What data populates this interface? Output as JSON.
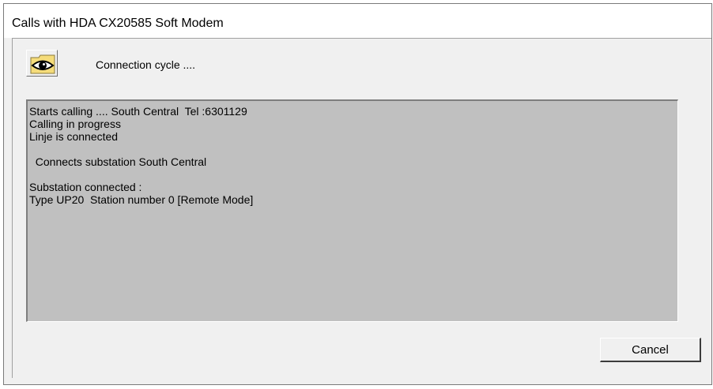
{
  "window": {
    "title": "Calls with HDA CX20585 Soft Modem"
  },
  "status": {
    "icon": "eye-icon",
    "label": "Connection cycle ...."
  },
  "log": {
    "lines": [
      "Starts calling .... South Central  Tel :6301129",
      "Calling in progress",
      "Linje is connected",
      "",
      "  Connects substation South Central",
      "",
      "Substation connected :",
      "Type UP20  Station number 0 [Remote Mode]"
    ]
  },
  "buttons": {
    "cancel_label": "Cancel"
  },
  "colors": {
    "window_bg": "#f0f0f0",
    "log_bg": "#c0c0c0",
    "icon_yellow": "#f5dc7a"
  }
}
